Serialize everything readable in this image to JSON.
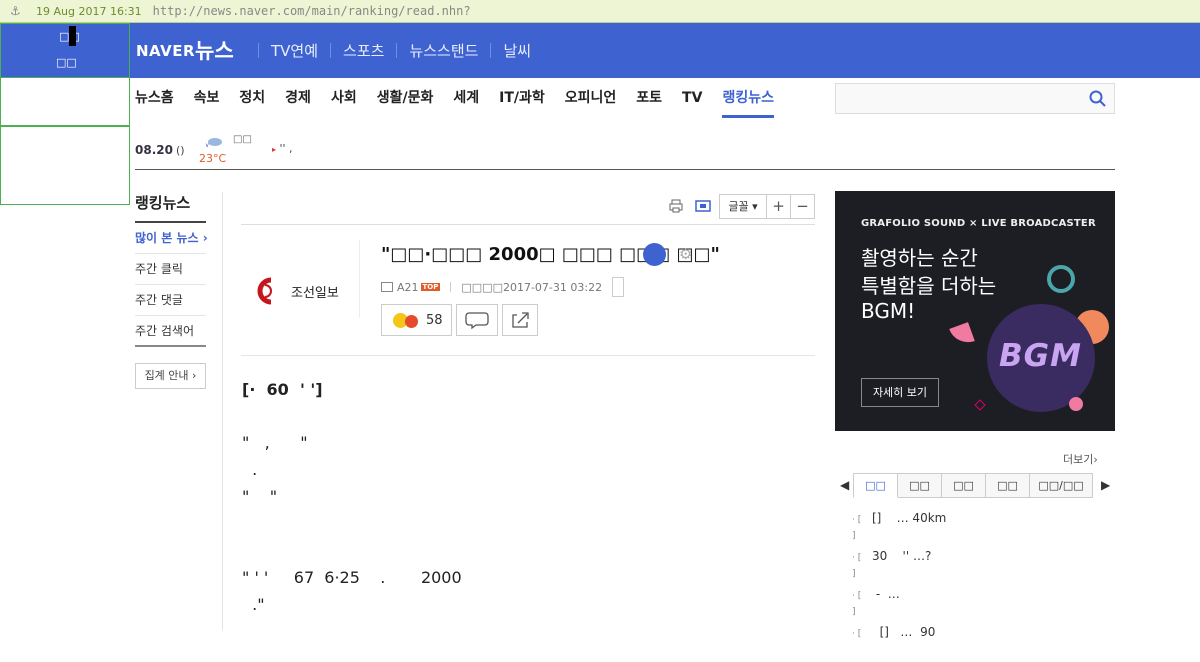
{
  "archive": {
    "date": "19 Aug 2017 16:31",
    "url": "http://news.naver.com/main/ranking/read.nhn?"
  },
  "header": {
    "logo_naver": "NAVER",
    "logo_news": "뉴스",
    "nav": [
      "TV연예",
      "스포츠",
      "뉴스스탠드",
      "날씨"
    ]
  },
  "overlay": {
    "line1": "□□",
    "line2": "□□"
  },
  "categories": [
    {
      "label": "뉴스홈"
    },
    {
      "label": "속보"
    },
    {
      "label": "정치"
    },
    {
      "label": "경제"
    },
    {
      "label": "사회"
    },
    {
      "label": "생활/문화"
    },
    {
      "label": "세계"
    },
    {
      "label": "IT/과학"
    },
    {
      "label": "오피니언"
    },
    {
      "label": "포토"
    },
    {
      "label": "TV"
    },
    {
      "label": "랭킹뉴스"
    }
  ],
  "search": {
    "placeholder": ""
  },
  "weather": {
    "date": "08.20",
    "paren": "()",
    "label": "□□",
    "temp": "23°C",
    "extra": "''  ,"
  },
  "left_menu": {
    "title": "랭킹뉴스",
    "items": [
      "많이 본 뉴스",
      "주간 클릭",
      "주간 댓글",
      "주간 검색어"
    ],
    "button": "집계 안내 ›"
  },
  "toolbar": {
    "font": "글꼴 ▾",
    "plus": "+",
    "minus": "−"
  },
  "article": {
    "press": "조선일보",
    "headline": "\"□□·□□□ 2000□ □□□ □□□ □□\"",
    "page": "A21",
    "top_badge": "TOP",
    "date_label": "□□□□",
    "date": "2017-07-31 03:22",
    "reaction_count": "58",
    "lead": "[·  60  ' ']",
    "para1": [
      "\"   ,      \"",
      "  .",
      "\"    \""
    ],
    "para2": [
      "\" ' '     67  6·25    .       2000",
      "  .\""
    ]
  },
  "ad": {
    "head": "GRAFOLIO SOUND × LIVE BROADCASTER",
    "line1": "촬영하는 순간",
    "line2": "특별함을 더하는",
    "line3": "BGM!",
    "button": "자세히 보기",
    "logo": "BGM"
  },
  "ranking": {
    "more": "더보기›",
    "tabs": [
      "□□",
      "□□",
      "□□",
      "□□",
      "□□/□□"
    ],
    "items": [
      {
        "num": "· [\n  ]",
        "text": "[]    … 40km"
      },
      {
        "num": "· [\n  ]",
        "text": "30    '' …?"
      },
      {
        "num": "· [\n  ]",
        "text": " -  …"
      },
      {
        "num": "· [",
        "text": "  []   …  90"
      }
    ]
  },
  "colors": {
    "brand": "#3e63d1",
    "archive_bg": "#eef5d4"
  }
}
